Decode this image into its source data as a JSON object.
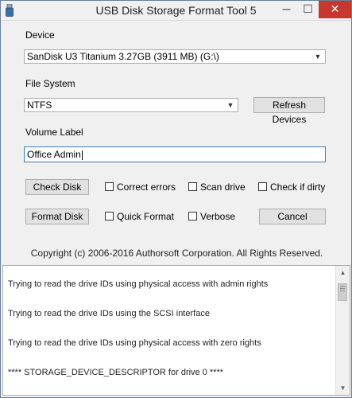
{
  "window": {
    "title": "USB Disk Storage Format Tool 5",
    "minimize": "─",
    "maximize": "☐",
    "close": "✕"
  },
  "device": {
    "label": "Device",
    "selected": "SanDisk U3 Titanium 3.27GB (3911 MB)  (G:\\)"
  },
  "file_system": {
    "label": "File System",
    "selected": "NTFS",
    "refresh_button": "Refresh Devices"
  },
  "volume_label": {
    "label": "Volume Label",
    "value": "Office Admin"
  },
  "actions": {
    "check_disk": "Check Disk",
    "format_disk": "Format Disk",
    "cancel": "Cancel"
  },
  "options": {
    "correct_errors": "Correct errors",
    "scan_drive": "Scan drive",
    "check_if_dirty": "Check if dirty",
    "quick_format": "Quick Format",
    "verbose": "Verbose"
  },
  "copyright": "Copyright (c) 2006-2016 Authorsoft Corporation. All Rights Reserved.",
  "log": [
    "Trying to read the drive IDs using physical access with admin rights",
    "Trying to read the drive IDs using the SCSI interface",
    "Trying to read the drive IDs using physical access with zero rights",
    "**** STORAGE_DEVICE_DESCRIPTOR for drive 0 ****"
  ],
  "icons": {
    "app": "usb-drive-icon",
    "dropdown": "chevron-down-icon",
    "scroll_up": "triangle-up-icon",
    "scroll_down": "triangle-down-icon"
  }
}
